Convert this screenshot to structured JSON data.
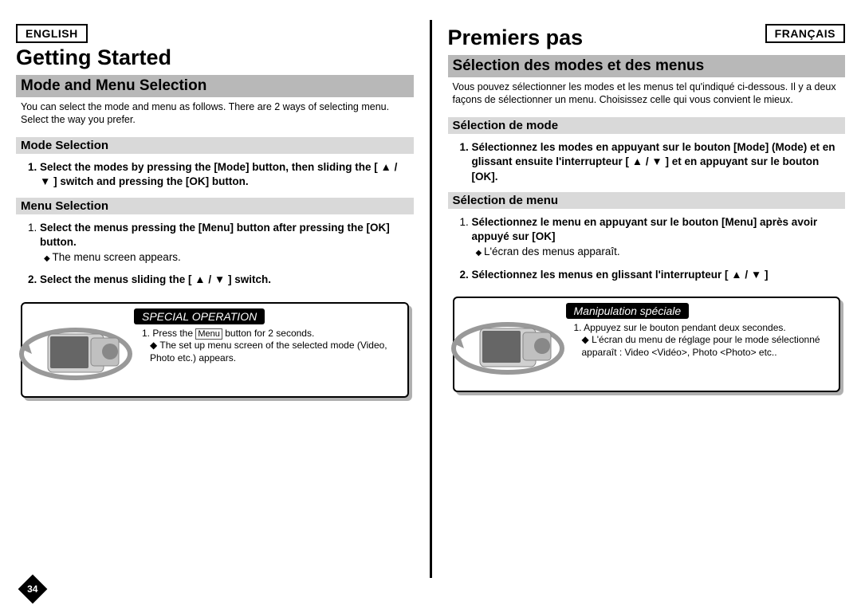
{
  "page_number": "34",
  "symbols": {
    "updown": "▲ / ▼"
  },
  "en": {
    "lang": "ENGLISH",
    "h1": "Getting Started",
    "section": "Mode and Menu Selection",
    "intro": "You can select the mode and menu as follows. There are 2 ways of selecting menu. Select the way you prefer.",
    "mode_sub": "Mode Selection",
    "mode_step": "Select the modes by pressing the [Mode] button, then sliding the [ ▲ / ▼ ] switch and pressing the [OK] button.",
    "menu_sub": "Menu Selection",
    "menu_step1": "Select the menus pressing the [Menu] button after pressing the [OK] button.",
    "menu_step1_sub": "The menu screen appears.",
    "menu_step2": "Select the menus sliding the [ ▲ / ▼ ] switch.",
    "special_title": "SPECIAL OPERATION",
    "special_step": "1. Press the ",
    "special_step_btn": "Menu",
    "special_step_after": " button for 2 seconds.",
    "special_sub": "The set up menu screen of the selected mode (Video, Photo etc.) appears."
  },
  "fr": {
    "lang": "FRANÇAIS",
    "h1": "Premiers pas",
    "section": "Sélection des modes et des menus",
    "intro": "Vous pouvez sélectionner les modes et les menus tel qu'indiqué ci-dessous. Il y a deux façons de sélectionner un menu. Choisissez celle qui vous convient le mieux.",
    "mode_sub": "Sélection de mode",
    "mode_step": "Sélectionnez les modes en appuyant sur le bouton [Mode] (Mode) et en glissant ensuite l'interrupteur [ ▲ / ▼ ] et en appuyant sur le bouton [OK].",
    "menu_sub": "Sélection de menu",
    "menu_step1": "Sélectionnez le menu en appuyant sur le bouton [Menu] après avoir appuyé sur [OK]",
    "menu_step1_sub": "L'écran des menus apparaît.",
    "menu_step2": "Sélectionnez les menus en glissant l'interrupteur [ ▲ / ▼ ]",
    "special_title": "Manipulation spéciale",
    "special_step": "1. Appuyez sur le bouton pendant deux secondes.",
    "special_sub": "L'écran du menu de réglage pour le mode sélectionné apparaît : Video <Vidéo>, Photo <Photo> etc.."
  }
}
